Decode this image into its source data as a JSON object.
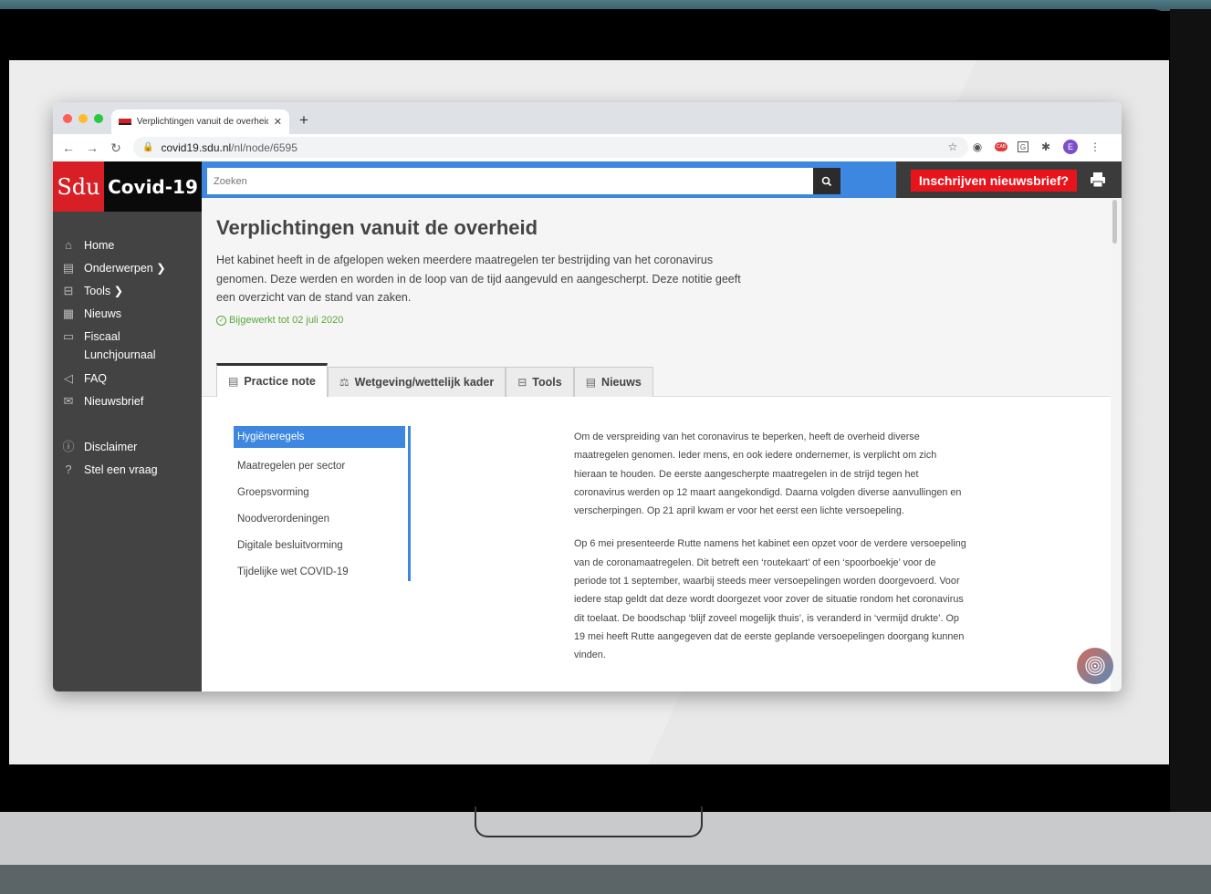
{
  "browser": {
    "tab_title": "Verplichtingen vanuit de overheid",
    "url_host": "covid19.sdu.nl",
    "url_path": "/nl/node/6595",
    "profile_initial": "E",
    "ext_badge_text": "CAB",
    "ext_g_text": "G"
  },
  "header": {
    "logo_sdu": "Sdu",
    "logo_covid": "Covid-19",
    "search_placeholder": "Zoeken",
    "subscribe_label": "Inschrijven nieuwsbrief?"
  },
  "sidebar": {
    "items": [
      {
        "label": "Home",
        "icon": "home-icon"
      },
      {
        "label": "Onderwerpen ❯",
        "icon": "document-icon"
      },
      {
        "label": "Tools ❯",
        "icon": "toolbox-icon"
      },
      {
        "label": "Nieuws",
        "icon": "newspaper-icon"
      },
      {
        "label": "Fiscaal Lunchjournaal",
        "icon": "tv-icon"
      },
      {
        "label": "FAQ",
        "icon": "megaphone-icon"
      },
      {
        "label": "Nieuwsbrief",
        "icon": "envelope-icon"
      },
      {
        "label": "Disclaimer",
        "icon": "info-icon"
      },
      {
        "label": "Stel een vraag",
        "icon": "question-icon"
      }
    ]
  },
  "page": {
    "title": "Verplichtingen vanuit de overheid",
    "intro": "Het kabinet heeft in de afgelopen weken meerdere maatregelen ter bestrijding van het coronavirus genomen. Deze werden en worden in de loop van de tijd aangevuld en aangescherpt. Deze notitie geeft een overzicht van de stand van zaken.",
    "updated": "Bijgewerkt tot 02 juli 2020",
    "tabs": [
      {
        "label": "Practice note",
        "icon": "document-icon"
      },
      {
        "label": "Wetgeving/wettelijk kader",
        "icon": "scales-icon"
      },
      {
        "label": "Tools",
        "icon": "toolbox-icon"
      },
      {
        "label": "Nieuws",
        "icon": "newspaper-icon"
      }
    ],
    "toc": [
      "Hygiëneregels",
      "Maatregelen per sector",
      "Groepsvorming",
      "Noodverordeningen",
      "Digitale besluitvorming",
      "Tijdelijke wet COVID-19"
    ],
    "paragraphs": [
      "Om de verspreiding van het coronavirus te beperken, heeft de overheid diverse maatregelen genomen. Ieder mens, en ook iedere ondernemer, is verplicht om zich hieraan te houden. De eerste aangescherpte maatregelen in de strijd tegen het coronavirus werden op 12 maart aangekondigd. Daarna volgden diverse aanvullingen en verscherpingen. Op 21 april kwam er voor het eerst een lichte versoepeling.",
      "Op 6 mei presenteerde Rutte namens het kabinet een opzet voor de verdere versoepeling van de coronamaatregelen. Dit betreft een ‘routekaart’ of een ‘spoorboekje’ voor de periode tot 1 september, waarbij steeds meer versoepelingen worden doorgevoerd. Voor iedere stap geldt dat deze wordt doorgezet voor zover de situatie rondom het coronavirus dit toelaat. De boodschap ‘blijf zoveel mogelijk thuis’, is veranderd in ‘vermijd drukte’. Op 19 mei heeft Rutte aangegeven dat de eerste geplande versoepelingen doorgang kunnen vinden."
    ]
  }
}
